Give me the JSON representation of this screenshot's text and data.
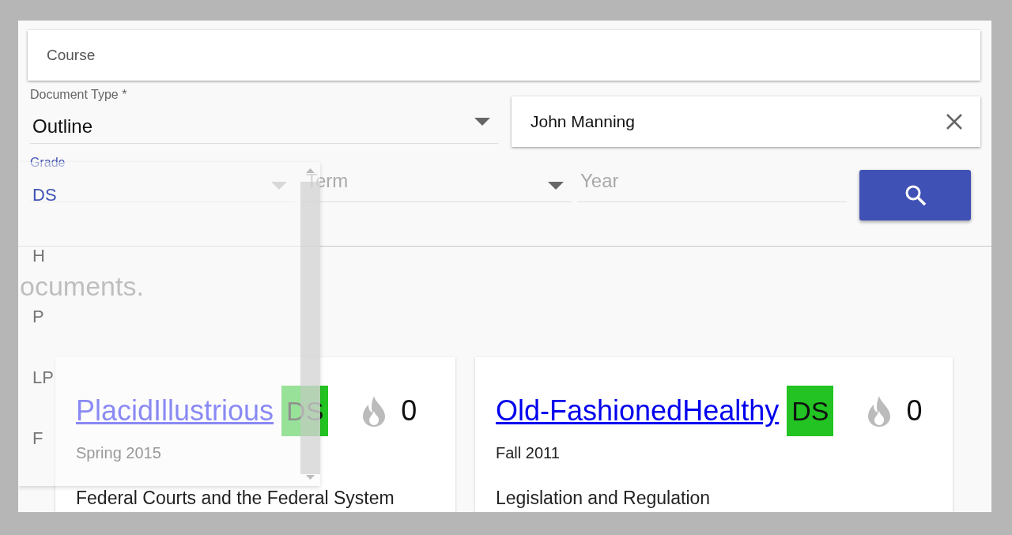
{
  "course_field": {
    "placeholder": "Course"
  },
  "document_type": {
    "label": "Document Type *",
    "value": "Outline"
  },
  "author_field": {
    "value": "John Manning"
  },
  "grade": {
    "label": "Grade",
    "menu": [
      {
        "label": "DS",
        "selected": true
      },
      {
        "label": "H",
        "selected": false
      },
      {
        "label": "P",
        "selected": false
      },
      {
        "label": "LP",
        "selected": false
      },
      {
        "label": "F",
        "selected": false
      }
    ]
  },
  "term": {
    "placeholder": "Term"
  },
  "year": {
    "placeholder": "Year"
  },
  "message": "ocuments.",
  "documents": [
    {
      "title": "PlacidIllustrious",
      "grade": "DS",
      "heat": "0",
      "term": "Spring 2015",
      "course": "Federal Courts and the Federal System"
    },
    {
      "title": "Old-FashionedHealthy",
      "grade": "DS",
      "heat": "0",
      "term": "Fall 2011",
      "course": "Legislation and Regulation"
    }
  ]
}
